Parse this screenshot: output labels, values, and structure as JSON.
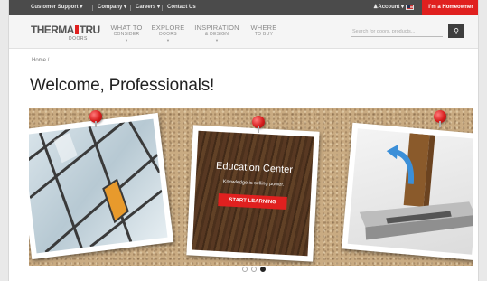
{
  "utility_bar": {
    "links": [
      "Customer Support",
      "Company",
      "Careers",
      "Contact Us"
    ],
    "account": "Account",
    "homeowner_button": "I'm a Homeowner"
  },
  "header": {
    "logo": {
      "left": "THERMA",
      "right": "TRU",
      "sub": "DOORS"
    },
    "nav": [
      {
        "line1": "WHAT TO",
        "line2": "CONSIDER"
      },
      {
        "line1": "EXPLORE",
        "line2": "DOORS"
      },
      {
        "line1": "INSPIRATION",
        "line2": "& DESIGN"
      },
      {
        "line1": "WHERE",
        "line2": "TO BUY"
      }
    ],
    "search_placeholder": "Search for doors, products...",
    "search_icon": "search-icon"
  },
  "breadcrumb": "Home /",
  "page_title": "Welcome, Professionals!",
  "banner": {
    "slide_title": "Education Center",
    "slide_tagline": "Knowledge is selling power.",
    "cta": "START LEARNING",
    "slides_total": 3,
    "active_slide": 3
  },
  "colors": {
    "accent": "#e0201f",
    "utility_bg": "#4b4b4b",
    "header_bg": "#f5f5f5"
  }
}
